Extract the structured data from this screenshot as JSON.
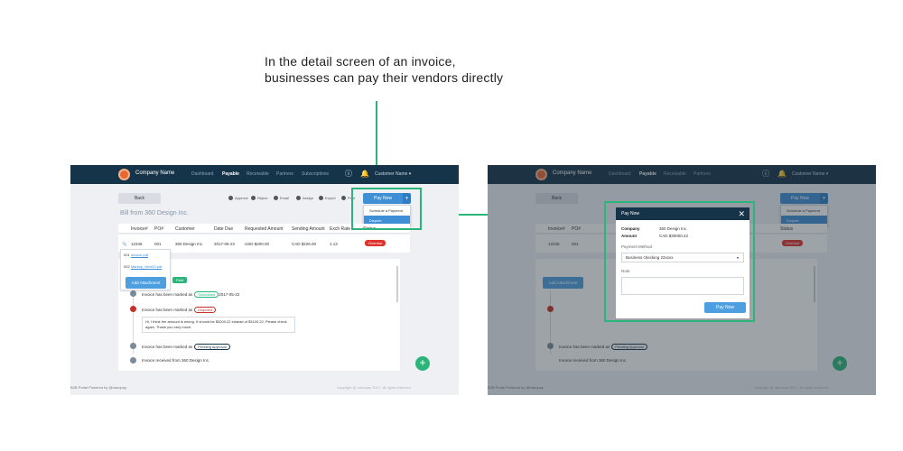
{
  "caption": {
    "line1": "In the detail screen of an invoice,",
    "line2": "businesses can pay their vendors directly"
  },
  "colors": {
    "highlight": "#2cb57a",
    "nav_bg": "#153449",
    "primary": "#3f8fd6",
    "danger": "#e0332c"
  },
  "app": {
    "company": "Company Name",
    "nav": [
      "Dashboard",
      "Payable",
      "Receivable",
      "Partners",
      "Subscriptions"
    ],
    "active_nav": "Payable",
    "user": "Customer Name ▾",
    "icons": [
      "info-icon",
      "bell-icon"
    ]
  },
  "toolbar": {
    "back": "Back",
    "actions": [
      "Approve",
      "Reject",
      "Email",
      "Assign",
      "Export",
      "Print"
    ],
    "pay_now": "Pay Now",
    "caret": "▾",
    "dropdown": [
      "Schedule a Payment",
      "Dispute"
    ]
  },
  "bill": {
    "title": "Bill from 360 Design Inc.",
    "headers": [
      "Invoice#",
      "PO#",
      "Customer",
      "Date Due",
      "Requested Amount",
      "Sending Amount",
      "Exch Rate",
      "Status"
    ],
    "row": [
      "12345",
      "001",
      "360 Design Inc.",
      "2017-05-22",
      "USD $200.00",
      "CAD $226.00",
      "1.13"
    ],
    "status": "Overdue"
  },
  "attachments": {
    "items": [
      {
        "num": "001",
        "file": "invoice.pdf"
      },
      {
        "num": "002",
        "file": "Markup_Item03.pdf"
      }
    ],
    "add": "Add Attachment"
  },
  "timeline": {
    "paid": "Paid",
    "events": [
      {
        "text": "Invoice has been marked as",
        "pill": "Scheduled",
        "tail": "2017-05-22"
      },
      {
        "text": "Invoice has been marked as",
        "pill": "Disputed",
        "tail": ""
      },
      {
        "text": "Invoice has been marked as",
        "pill": "Pending Approval",
        "tail": ""
      },
      {
        "text": "Invoice received from 360 Design Inc.",
        "pill": "",
        "tail": ""
      }
    ],
    "comment": "Hi, I think the amount is wrong. It should be $3000.22 instead of $3100.22. Please check again. Thank you very much.",
    "fab": "+"
  },
  "footer": {
    "left": "B2B Portal Powered by @nanopay",
    "right": "copyright @ nanopay 2017. all rights reserved."
  },
  "modal": {
    "title": "Pay Now",
    "close": "✕",
    "company_label": "Company",
    "company_value": "360 Design Inc.",
    "amount_label": "Amount",
    "amount_value": "CAD $30000.22",
    "method_label": "Payment Method",
    "method_value": "Business checking 22xxxx",
    "note_label": "Note",
    "pay_button": "Pay Now"
  }
}
